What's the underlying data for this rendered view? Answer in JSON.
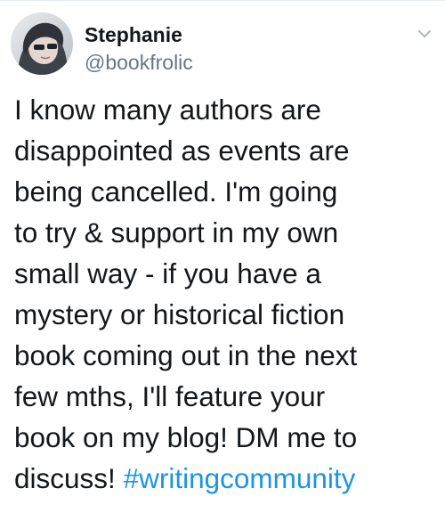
{
  "tweet": {
    "author": {
      "display_name": "Stephanie",
      "handle": "@bookfrolic",
      "avatar_icon": "profile-photo"
    },
    "menu_icon": "chevron-down-icon",
    "text_lines": [
      "I know many authors are",
      "disappointed as events are",
      "being cancelled. I'm going",
      "to try & support in my own",
      "small way - if you have a",
      "mystery or historical fiction",
      "book coming out in the next",
      "few mths, I'll feature your",
      "book on my blog! DM me to",
      "discuss!"
    ],
    "hashtag": "#writingcommunity"
  },
  "colors": {
    "text": "#14171a",
    "handle": "#657786",
    "link": "#1b95e0",
    "chevron": "#aab8c2"
  }
}
